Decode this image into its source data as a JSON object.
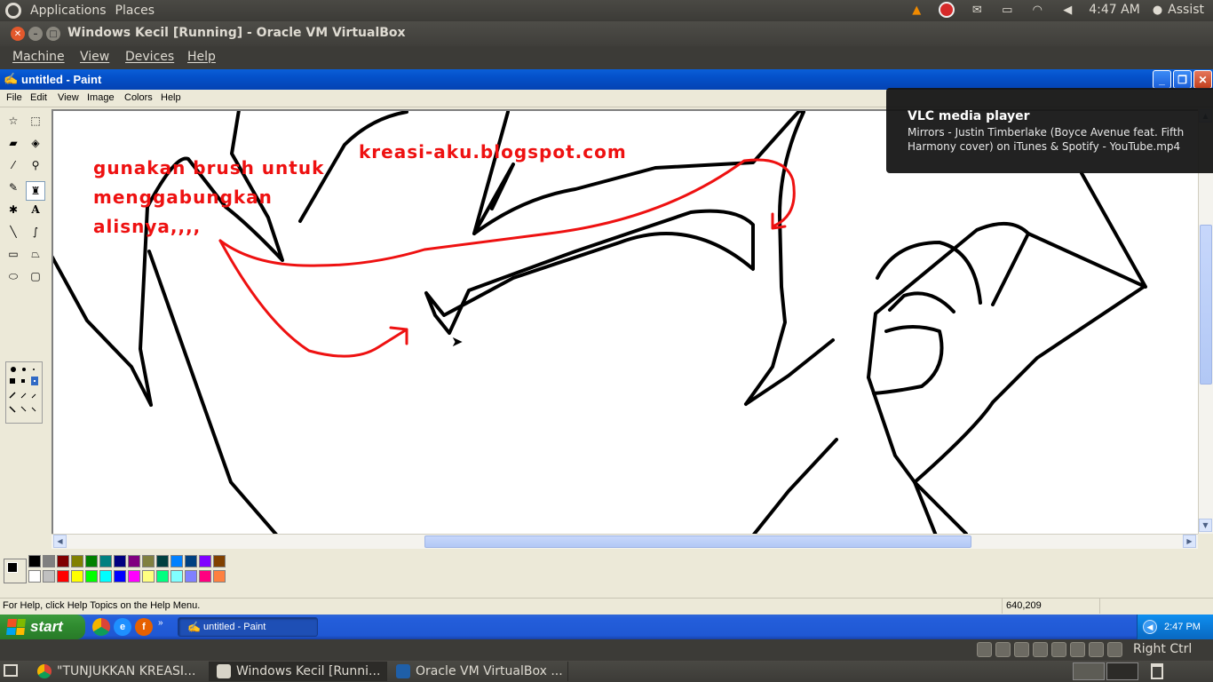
{
  "top_panel": {
    "applications": "Applications",
    "places": "Places",
    "clock": "4:47 AM",
    "user": "Assist"
  },
  "vbox": {
    "title": "Windows Kecil [Running] - Oracle VM VirtualBox",
    "menu": [
      "Machine",
      "View",
      "Devices",
      "Help"
    ],
    "host_key": "Right Ctrl"
  },
  "paint": {
    "title": "untitled - Paint",
    "menu": [
      "File",
      "Edit",
      "View",
      "Image",
      "Colors",
      "Help"
    ],
    "status_message": "For Help, click Help Topics on the Help Menu.",
    "coords": "640,209",
    "palette_top": [
      "#000000",
      "#808080",
      "#800000",
      "#808000",
      "#008000",
      "#008080",
      "#000080",
      "#800080",
      "#808040",
      "#004040",
      "#0080ff",
      "#004080",
      "#8000ff",
      "#804000"
    ],
    "palette_bottom": [
      "#ffffff",
      "#c0c0c0",
      "#ff0000",
      "#ffff00",
      "#00ff00",
      "#00ffff",
      "#0000ff",
      "#ff00ff",
      "#ffff80",
      "#00ff80",
      "#80ffff",
      "#8080ff",
      "#ff0080",
      "#ff8040"
    ],
    "canvas_text": {
      "line1": "gunakan brush untuk",
      "line2": "menggabungkan",
      "line3": "alisnya,,,,",
      "blog": "kreasi-aku.blogspot.com"
    }
  },
  "xp_taskbar": {
    "start": "start",
    "task": "untitled - Paint",
    "clock": "2:47 PM"
  },
  "bottom_panel": {
    "tasks": [
      "\"TUNJUKKAN KREASI...",
      "Windows Kecil [Runni...",
      "Oracle VM VirtualBox ..."
    ]
  },
  "vlc_notification": {
    "title": "VLC media player",
    "body": "Mirrors - Justin Timberlake (Boyce Avenue feat. Fifth Harmony cover) on iTunes & Spotify - YouTube.mp4"
  },
  "colors": {
    "annotation_red": "#ee1111",
    "xp_blue": "#0a5fd8",
    "ubuntu_panel": "#3c3b37"
  }
}
